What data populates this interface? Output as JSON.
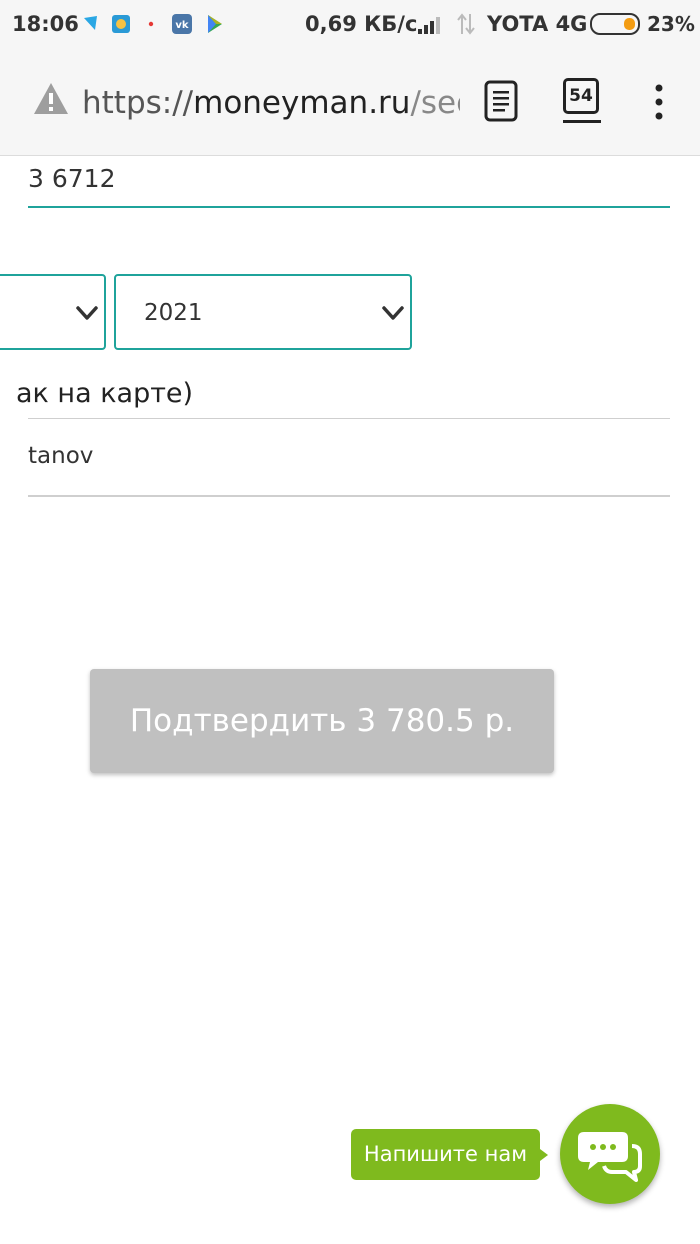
{
  "status_bar": {
    "time": "18:06",
    "network_speed": "0,69 КБ/с",
    "carrier": "YOTA 4G",
    "battery_percent": "23%",
    "app_icons": [
      "telegram-icon",
      "mail-icon",
      "notification-dot-icon",
      "vk-icon",
      "play-store-icon"
    ]
  },
  "browser": {
    "url_prefix": "https://",
    "url_host": "moneyman.ru",
    "url_rest": "/secur",
    "tab_count": "54",
    "icons": [
      "warning-icon",
      "reader-mode-icon",
      "tabs-icon",
      "overflow-menu-icon"
    ]
  },
  "form": {
    "card_number_visible": "3 6712",
    "month_select": {
      "value": ""
    },
    "year_select": {
      "value": "2021"
    },
    "holder_label": "ак на карте)",
    "holder_value": "tanov"
  },
  "confirm_button": {
    "label": "Подтвердить 3 780.5 р."
  },
  "chat": {
    "label": "Напишите нам"
  },
  "colors": {
    "accent": "#1fa39b",
    "button_disabled": "#c0c0c0",
    "chat_green": "#7fba1e"
  }
}
